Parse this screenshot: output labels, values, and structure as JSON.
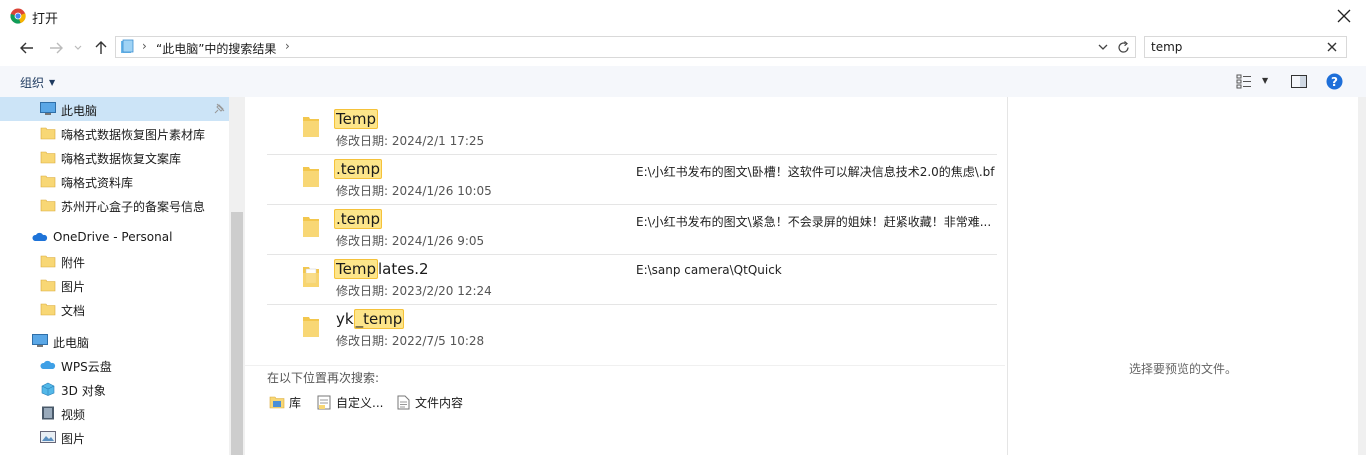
{
  "window": {
    "title": "打开",
    "app_icon": "chrome-icon",
    "close_icon": "close-icon"
  },
  "address": {
    "path_label": "“此电脑”中的搜索结果",
    "search_value": "temp"
  },
  "toolbar": {
    "organize_label": "组织"
  },
  "nav": {
    "items": [
      {
        "label": "此电脑",
        "icon": "computer-icon",
        "pinned": true
      },
      {
        "label": "嗨格式数据恢复图片素材库",
        "icon": "folder-icon"
      },
      {
        "label": "嗨格式数据恢复文案库",
        "icon": "folder-icon"
      },
      {
        "label": "嗨格式资料库",
        "icon": "folder-icon"
      },
      {
        "label": "苏州开心盒子的备案号信息",
        "icon": "folder-icon"
      },
      {
        "label": "OneDrive - Personal",
        "icon": "onedrive-icon"
      },
      {
        "label": "附件",
        "icon": "folder-icon"
      },
      {
        "label": "图片",
        "icon": "folder-icon"
      },
      {
        "label": "文档",
        "icon": "folder-icon"
      },
      {
        "label": "此电脑",
        "icon": "computer-icon"
      },
      {
        "label": "WPS云盘",
        "icon": "cloud-icon"
      },
      {
        "label": "3D 对象",
        "icon": "3d-objects-icon"
      },
      {
        "label": "视频",
        "icon": "video-icon"
      },
      {
        "label": "图片",
        "icon": "pictures-icon"
      }
    ]
  },
  "results": {
    "date_prefix": "修改日期:",
    "rows": [
      {
        "name_hl": "Temp",
        "name_pre": "",
        "name_post": "",
        "date": "2024/2/1 17:25",
        "path": ""
      },
      {
        "name_hl": ".temp",
        "name_pre": "",
        "name_post": "",
        "date": "2024/1/26 10:05",
        "path": "E:\\小红书发布的图文\\卧槽！这软件可以解决信息技术2.0的焦虑\\.bf"
      },
      {
        "name_hl": ".temp",
        "name_pre": "",
        "name_post": "",
        "date": "2024/1/26 9:05",
        "path": "E:\\小红书发布的图文\\紧急！不会录屏的姐妹！赶紧收藏！非常难..."
      },
      {
        "name_hl": "Temp",
        "name_pre": "",
        "name_post": "lates.2",
        "date": "2023/2/20 12:24",
        "path": "E:\\sanp camera\\QtQuick"
      },
      {
        "name_hl": "_temp",
        "name_pre": "yk",
        "name_post": "",
        "date": "2022/7/5 10:28",
        "path": ""
      }
    ]
  },
  "search_again": {
    "heading": "在以下位置再次搜索:",
    "options": [
      {
        "label": "库",
        "icon": "library-icon"
      },
      {
        "label": "自定义...",
        "icon": "custom-folder-icon"
      },
      {
        "label": "文件内容",
        "icon": "file-contents-icon"
      }
    ]
  },
  "preview": {
    "message": "选择要预览的文件。"
  },
  "colors": {
    "highlight": "#fde58a",
    "selection": "#cce4f7",
    "folder": "#f8d775",
    "help": "#1e6fd9"
  }
}
